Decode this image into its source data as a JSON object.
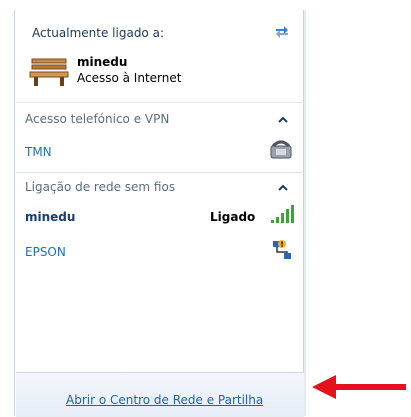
{
  "header": {
    "connected_label": "Actualmente ligado a:"
  },
  "current_network": {
    "name": "minedu",
    "status": "Acesso à Internet"
  },
  "sections": {
    "dialup_vpn": {
      "title": "Acesso telefónico e VPN",
      "items": [
        {
          "name": "TMN"
        }
      ]
    },
    "wireless": {
      "title": "Ligação de rede sem fios",
      "items": [
        {
          "name": "minedu",
          "status": "Ligado",
          "signal_bars": 5
        },
        {
          "name": "EPSON"
        }
      ]
    }
  },
  "footer": {
    "link_label": "Abrir o Centro de Rede e Partilha"
  },
  "colors": {
    "accent_link": "#1f62ad",
    "signal_green": "#3aa636",
    "arrow_red": "#e3121b"
  },
  "icons": [
    "refresh-icon",
    "bench-network-icon",
    "chevron-up-icon",
    "phone-modem-icon",
    "signal-strength-icon",
    "adhoc-network-icon"
  ]
}
